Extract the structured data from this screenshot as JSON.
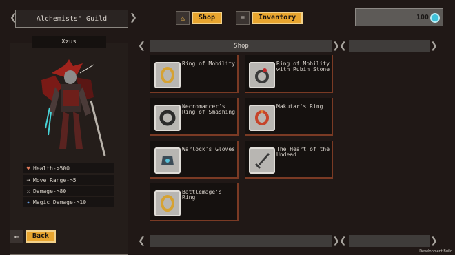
{
  "header": {
    "guild_name": "Alchemists' Guild",
    "shop_label": "Shop",
    "inventory_label": "Inventory",
    "gold": "100"
  },
  "character": {
    "name": "Xzus",
    "stats": [
      {
        "icon": "heart-icon",
        "label": "Health->500"
      },
      {
        "icon": "arrow-icon",
        "label": "Move Range->5"
      },
      {
        "icon": "sword-icon",
        "label": "Damage->80"
      },
      {
        "icon": "wand-icon",
        "label": "Magic Damage->10"
      }
    ],
    "back_label": "Back"
  },
  "shop": {
    "title": "Shop",
    "items": [
      {
        "name": "Ring of Mobility",
        "icon": "gold-ring-icon"
      },
      {
        "name": "Ring of Mobility with Rubin Stone",
        "icon": "ruby-ring-icon"
      },
      {
        "name": "Necromancer's Ring of Smashing",
        "icon": "dark-ring-icon"
      },
      {
        "name": "Makutar's Ring",
        "icon": "fire-ring-icon"
      },
      {
        "name": "Warlock's Gloves",
        "icon": "gloves-icon"
      },
      {
        "name": "The Heart of the Undead",
        "icon": "dagger-icon"
      },
      {
        "name": "Battlemage's Ring",
        "icon": "gold-ring-icon"
      }
    ]
  },
  "footer": {
    "build_label": "Development Build"
  },
  "colors": {
    "accent": "#e8a52f",
    "panel": "#241d1a",
    "item_border": "#7a3a24",
    "gem": "#3fc1d9"
  }
}
